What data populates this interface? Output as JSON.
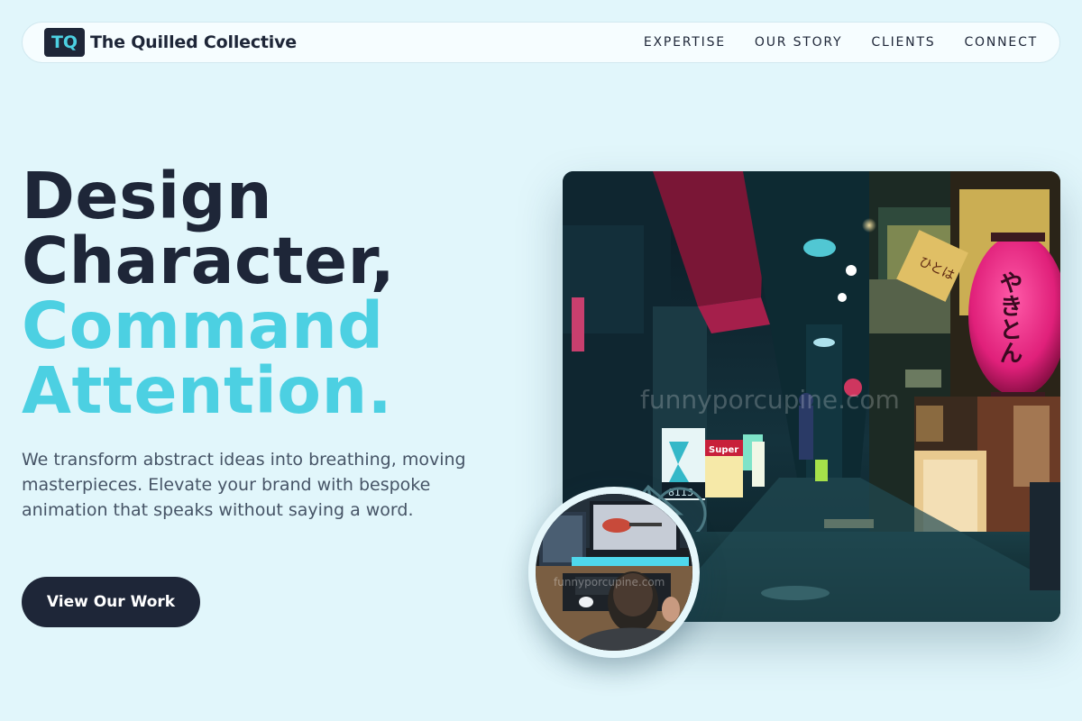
{
  "brand": {
    "badge": "TQ",
    "name": "The Quilled Collective"
  },
  "nav": {
    "links": [
      "EXPERTISE",
      "OUR STORY",
      "CLIENTS",
      "CONNECT"
    ]
  },
  "hero": {
    "title_line1": "Design",
    "title_line2": "Character,",
    "title_line3": "Command",
    "title_line4": "Attention.",
    "description": "We transform abstract ideas into breathing, moving masterpieces. Elevate your brand with bespoke animation that speaks without saying a word.",
    "cta_label": "View Our Work"
  },
  "images": {
    "main_watermark": "funnyporcupine.com",
    "circle_watermark": "funnyporcupine.com",
    "lantern_text": "やきとん",
    "sign_text": "Super",
    "street_number": "-8113"
  },
  "colors": {
    "dark": "#1e2638",
    "accent": "#4cd0e2",
    "background": "#e1f6fb"
  }
}
